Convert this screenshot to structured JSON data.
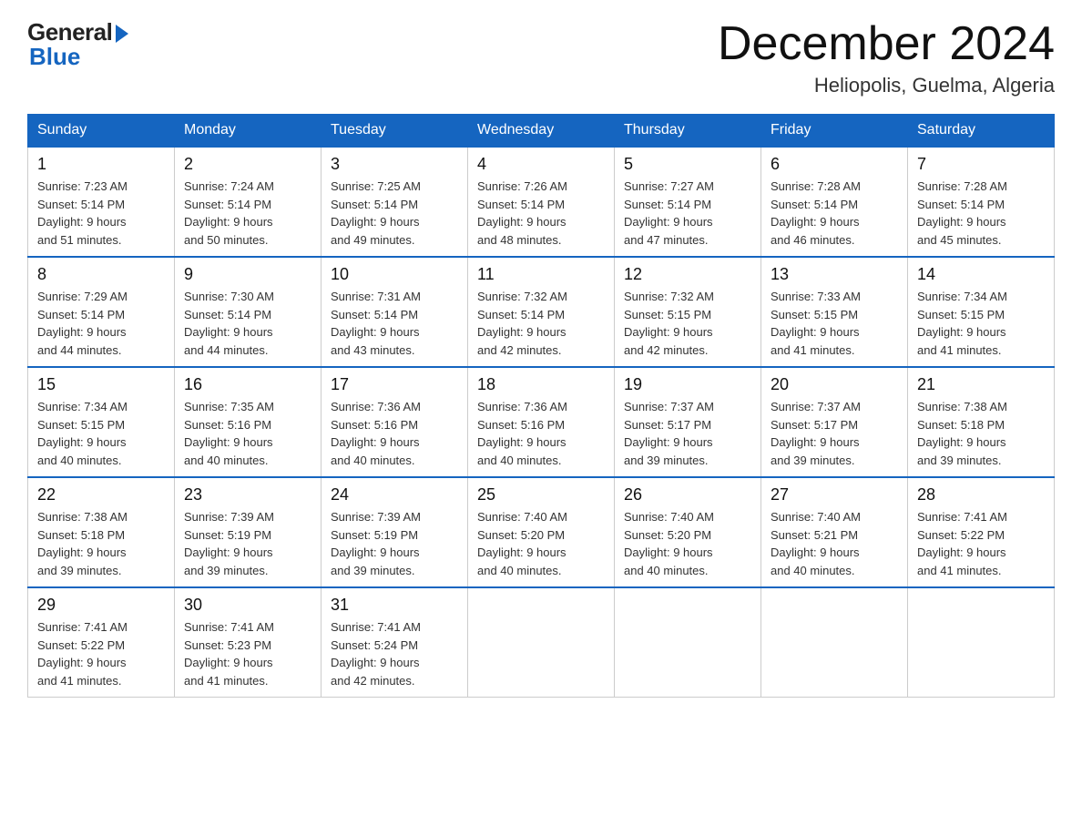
{
  "header": {
    "logo_general": "General",
    "logo_blue": "Blue",
    "month_title": "December 2024",
    "location": "Heliopolis, Guelma, Algeria"
  },
  "days_of_week": [
    "Sunday",
    "Monday",
    "Tuesday",
    "Wednesday",
    "Thursday",
    "Friday",
    "Saturday"
  ],
  "weeks": [
    [
      {
        "num": "1",
        "sunrise": "7:23 AM",
        "sunset": "5:14 PM",
        "daylight": "9 hours and 51 minutes."
      },
      {
        "num": "2",
        "sunrise": "7:24 AM",
        "sunset": "5:14 PM",
        "daylight": "9 hours and 50 minutes."
      },
      {
        "num": "3",
        "sunrise": "7:25 AM",
        "sunset": "5:14 PM",
        "daylight": "9 hours and 49 minutes."
      },
      {
        "num": "4",
        "sunrise": "7:26 AM",
        "sunset": "5:14 PM",
        "daylight": "9 hours and 48 minutes."
      },
      {
        "num": "5",
        "sunrise": "7:27 AM",
        "sunset": "5:14 PM",
        "daylight": "9 hours and 47 minutes."
      },
      {
        "num": "6",
        "sunrise": "7:28 AM",
        "sunset": "5:14 PM",
        "daylight": "9 hours and 46 minutes."
      },
      {
        "num": "7",
        "sunrise": "7:28 AM",
        "sunset": "5:14 PM",
        "daylight": "9 hours and 45 minutes."
      }
    ],
    [
      {
        "num": "8",
        "sunrise": "7:29 AM",
        "sunset": "5:14 PM",
        "daylight": "9 hours and 44 minutes."
      },
      {
        "num": "9",
        "sunrise": "7:30 AM",
        "sunset": "5:14 PM",
        "daylight": "9 hours and 44 minutes."
      },
      {
        "num": "10",
        "sunrise": "7:31 AM",
        "sunset": "5:14 PM",
        "daylight": "9 hours and 43 minutes."
      },
      {
        "num": "11",
        "sunrise": "7:32 AM",
        "sunset": "5:14 PM",
        "daylight": "9 hours and 42 minutes."
      },
      {
        "num": "12",
        "sunrise": "7:32 AM",
        "sunset": "5:15 PM",
        "daylight": "9 hours and 42 minutes."
      },
      {
        "num": "13",
        "sunrise": "7:33 AM",
        "sunset": "5:15 PM",
        "daylight": "9 hours and 41 minutes."
      },
      {
        "num": "14",
        "sunrise": "7:34 AM",
        "sunset": "5:15 PM",
        "daylight": "9 hours and 41 minutes."
      }
    ],
    [
      {
        "num": "15",
        "sunrise": "7:34 AM",
        "sunset": "5:15 PM",
        "daylight": "9 hours and 40 minutes."
      },
      {
        "num": "16",
        "sunrise": "7:35 AM",
        "sunset": "5:16 PM",
        "daylight": "9 hours and 40 minutes."
      },
      {
        "num": "17",
        "sunrise": "7:36 AM",
        "sunset": "5:16 PM",
        "daylight": "9 hours and 40 minutes."
      },
      {
        "num": "18",
        "sunrise": "7:36 AM",
        "sunset": "5:16 PM",
        "daylight": "9 hours and 40 minutes."
      },
      {
        "num": "19",
        "sunrise": "7:37 AM",
        "sunset": "5:17 PM",
        "daylight": "9 hours and 39 minutes."
      },
      {
        "num": "20",
        "sunrise": "7:37 AM",
        "sunset": "5:17 PM",
        "daylight": "9 hours and 39 minutes."
      },
      {
        "num": "21",
        "sunrise": "7:38 AM",
        "sunset": "5:18 PM",
        "daylight": "9 hours and 39 minutes."
      }
    ],
    [
      {
        "num": "22",
        "sunrise": "7:38 AM",
        "sunset": "5:18 PM",
        "daylight": "9 hours and 39 minutes."
      },
      {
        "num": "23",
        "sunrise": "7:39 AM",
        "sunset": "5:19 PM",
        "daylight": "9 hours and 39 minutes."
      },
      {
        "num": "24",
        "sunrise": "7:39 AM",
        "sunset": "5:19 PM",
        "daylight": "9 hours and 39 minutes."
      },
      {
        "num": "25",
        "sunrise": "7:40 AM",
        "sunset": "5:20 PM",
        "daylight": "9 hours and 40 minutes."
      },
      {
        "num": "26",
        "sunrise": "7:40 AM",
        "sunset": "5:20 PM",
        "daylight": "9 hours and 40 minutes."
      },
      {
        "num": "27",
        "sunrise": "7:40 AM",
        "sunset": "5:21 PM",
        "daylight": "9 hours and 40 minutes."
      },
      {
        "num": "28",
        "sunrise": "7:41 AM",
        "sunset": "5:22 PM",
        "daylight": "9 hours and 41 minutes."
      }
    ],
    [
      {
        "num": "29",
        "sunrise": "7:41 AM",
        "sunset": "5:22 PM",
        "daylight": "9 hours and 41 minutes."
      },
      {
        "num": "30",
        "sunrise": "7:41 AM",
        "sunset": "5:23 PM",
        "daylight": "9 hours and 41 minutes."
      },
      {
        "num": "31",
        "sunrise": "7:41 AM",
        "sunset": "5:24 PM",
        "daylight": "9 hours and 42 minutes."
      },
      null,
      null,
      null,
      null
    ]
  ],
  "labels": {
    "sunrise": "Sunrise:",
    "sunset": "Sunset:",
    "daylight": "Daylight:"
  }
}
